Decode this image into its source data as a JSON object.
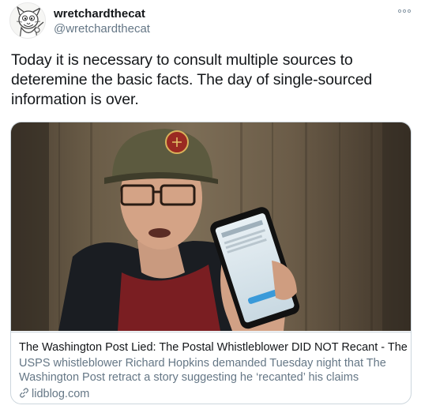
{
  "user": {
    "display_name": "wretchardthecat",
    "handle": "@wretchardthecat"
  },
  "icons": {
    "avatar": "cartoon-cat-avatar",
    "more": "more-options-icon",
    "link": "link-icon"
  },
  "tweet": {
    "text": "Today it is necessary to consult multiple sources to deteremine the basic facts. The day of single-sourced information is over."
  },
  "card": {
    "title": "The Washington Post Lied: The Postal Whistleblower DID NOT Recant - The Lid",
    "description": "USPS whistleblower Richard Hopkins demanded Tuesday night that The Washington Post retract a story suggesting he ‘recanted’ his claims",
    "domain": "lidblog.com"
  },
  "colors": {
    "text_primary": "#14171a",
    "text_secondary": "#657786",
    "border": "#ccd6dd"
  }
}
